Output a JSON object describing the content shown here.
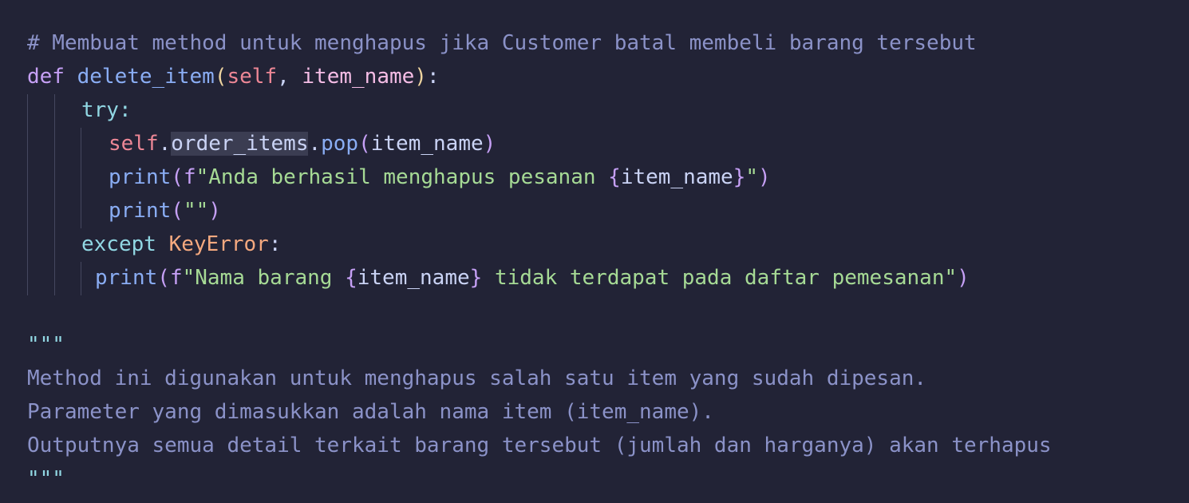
{
  "colors": {
    "background": "#222336",
    "comment": "#8b92c8",
    "keyword": "#c6a0f6",
    "function": "#8aadf4",
    "string": "#a6da95",
    "self": "#ed8796",
    "exception_class": "#f5a97f",
    "control_flow": "#91d7e3"
  },
  "code": {
    "l1_comment": "# Membuat method untuk menghapus jika Customer batal membeli barang tersebut",
    "l2_def": "def",
    "l2_fname": "delete_item",
    "l2_open": "(",
    "l2_self": "self",
    "l2_comma": ", ",
    "l2_param": "item_name",
    "l2_close": ")",
    "l2_colon": ":",
    "l3_try": "try:",
    "l4_self": "self",
    "l4_dot1": ".",
    "l4_prop": "order_items",
    "l4_dot2": ".",
    "l4_pop": "pop",
    "l4_open": "(",
    "l4_arg": "item_name",
    "l4_close": ")",
    "l5_print": "print",
    "l5_open": "(",
    "l5_f": "f",
    "l5_str1": "\"Anda berhasil menghapus pesanan ",
    "l5_lbrace": "{",
    "l5_var": "item_name",
    "l5_rbrace": "}",
    "l5_str2": "\"",
    "l5_close": ")",
    "l6_print": "print",
    "l6_open": "(",
    "l6_str": "\"\"",
    "l6_close": ")",
    "l7_except": "except",
    "l7_class": "KeyError",
    "l7_colon": ":",
    "l8_print": "print",
    "l8_open": "(",
    "l8_f": "f",
    "l8_str1": "\"Nama barang ",
    "l8_lbrace": "{",
    "l8_var": "item_name",
    "l8_rbrace": "}",
    "l8_str2": " tidak terdapat pada daftar pemesanan\"",
    "l8_close": ")",
    "l10_docquote": "\"\"\"",
    "l11_doc": "Method ini digunakan untuk menghapus salah satu item yang sudah dipesan.",
    "l12_doc": "Parameter yang dimasukkan adalah nama item (item_name).",
    "l13_doc": "Outputnya semua detail terkait barang tersebut (jumlah dan harganya) akan terhapus",
    "l14_docquote": "\"\"\""
  }
}
